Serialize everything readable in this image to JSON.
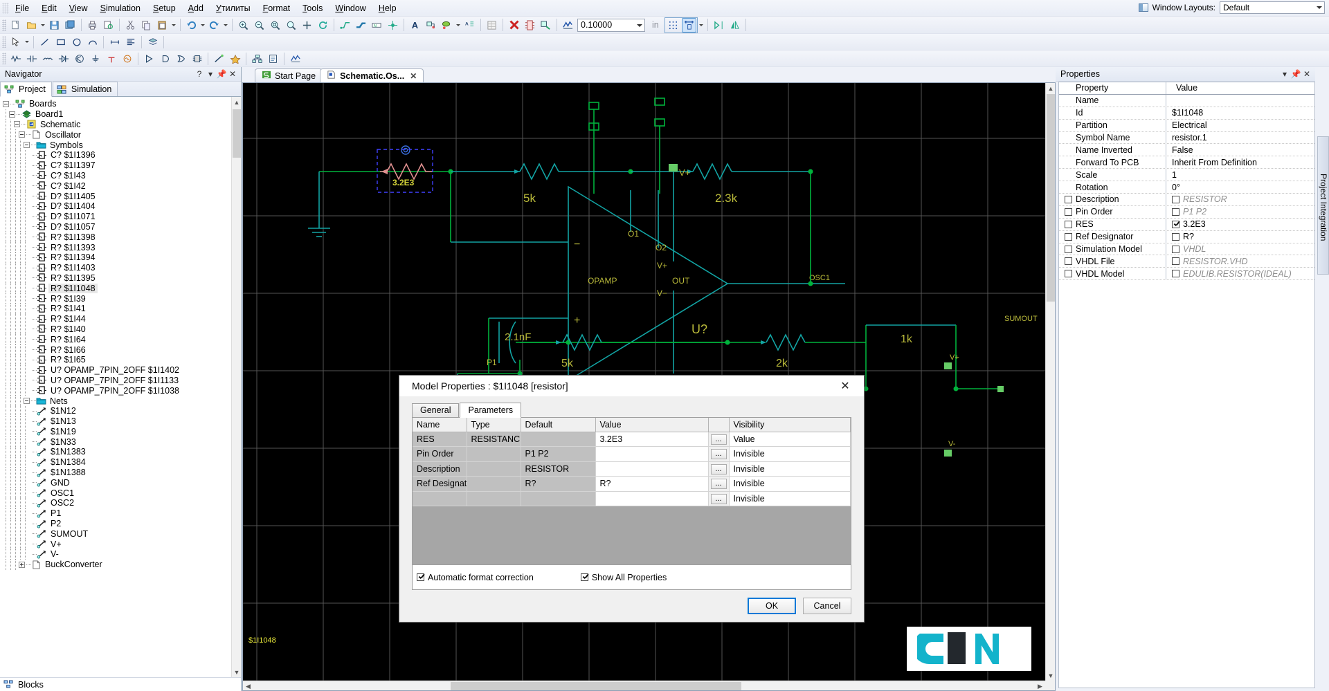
{
  "menu": {
    "items": [
      "File",
      "Edit",
      "View",
      "Simulation",
      "Setup",
      "Add",
      "Утилиты",
      "Format",
      "Tools",
      "Window",
      "Help"
    ]
  },
  "window_layouts": {
    "label": "Window Layouts:",
    "value": "Default"
  },
  "toolbar": {
    "zoom_value": "0.10000",
    "unit": "in"
  },
  "navigator": {
    "title": "Navigator",
    "tabs": [
      {
        "label": "Project",
        "icon": "project-icon",
        "active": true
      },
      {
        "label": "Simulation",
        "icon": "simulation-icon",
        "active": false
      }
    ],
    "tree": [
      {
        "label": "Boards",
        "depth": 0,
        "exp": "minus",
        "icon": "boards-icon"
      },
      {
        "label": "Board1",
        "depth": 1,
        "exp": "minus",
        "icon": "board-icon"
      },
      {
        "label": "Schematic",
        "depth": 2,
        "exp": "minus",
        "icon": "schematic-icon"
      },
      {
        "label": "Oscillator",
        "depth": 3,
        "exp": "minus",
        "icon": "page-icon"
      },
      {
        "label": "Symbols",
        "depth": 4,
        "exp": "minus",
        "icon": "folder-icon"
      },
      {
        "label": "C? $1I1396",
        "depth": 5,
        "exp": "none",
        "icon": "symbol-icon"
      },
      {
        "label": "C? $1I1397",
        "depth": 5,
        "exp": "none",
        "icon": "symbol-icon"
      },
      {
        "label": "C? $1I43",
        "depth": 5,
        "exp": "none",
        "icon": "symbol-icon"
      },
      {
        "label": "C? $1I42",
        "depth": 5,
        "exp": "none",
        "icon": "symbol-icon"
      },
      {
        "label": "D? $1I1405",
        "depth": 5,
        "exp": "none",
        "icon": "symbol-icon"
      },
      {
        "label": "D? $1I1404",
        "depth": 5,
        "exp": "none",
        "icon": "symbol-icon"
      },
      {
        "label": "D? $1I1071",
        "depth": 5,
        "exp": "none",
        "icon": "symbol-icon"
      },
      {
        "label": "D? $1I1057",
        "depth": 5,
        "exp": "none",
        "icon": "symbol-icon"
      },
      {
        "label": "R? $1I1398",
        "depth": 5,
        "exp": "none",
        "icon": "symbol-icon"
      },
      {
        "label": "R? $1I1393",
        "depth": 5,
        "exp": "none",
        "icon": "symbol-icon"
      },
      {
        "label": "R? $1I1394",
        "depth": 5,
        "exp": "none",
        "icon": "symbol-icon"
      },
      {
        "label": "R? $1I1403",
        "depth": 5,
        "exp": "none",
        "icon": "symbol-icon"
      },
      {
        "label": "R? $1I1395",
        "depth": 5,
        "exp": "none",
        "icon": "symbol-icon"
      },
      {
        "label": "R? $1I1048",
        "depth": 5,
        "exp": "none",
        "icon": "symbol-icon",
        "selected": true
      },
      {
        "label": "R? $1I39",
        "depth": 5,
        "exp": "none",
        "icon": "symbol-icon"
      },
      {
        "label": "R? $1I41",
        "depth": 5,
        "exp": "none",
        "icon": "symbol-icon"
      },
      {
        "label": "R? $1I44",
        "depth": 5,
        "exp": "none",
        "icon": "symbol-icon"
      },
      {
        "label": "R? $1I40",
        "depth": 5,
        "exp": "none",
        "icon": "symbol-icon"
      },
      {
        "label": "R? $1I64",
        "depth": 5,
        "exp": "none",
        "icon": "symbol-icon"
      },
      {
        "label": "R? $1I66",
        "depth": 5,
        "exp": "none",
        "icon": "symbol-icon"
      },
      {
        "label": "R? $1I65",
        "depth": 5,
        "exp": "none",
        "icon": "symbol-icon"
      },
      {
        "label": "U? OPAMP_7PIN_2OFF $1I1402",
        "depth": 5,
        "exp": "none",
        "icon": "symbol-icon"
      },
      {
        "label": "U? OPAMP_7PIN_2OFF $1I1133",
        "depth": 5,
        "exp": "none",
        "icon": "symbol-icon"
      },
      {
        "label": "U? OPAMP_7PIN_2OFF $1I1038",
        "depth": 5,
        "exp": "none",
        "icon": "symbol-icon"
      },
      {
        "label": "Nets",
        "depth": 4,
        "exp": "minus",
        "icon": "folder-icon"
      },
      {
        "label": "$1N12",
        "depth": 5,
        "exp": "none",
        "icon": "net-icon"
      },
      {
        "label": "$1N13",
        "depth": 5,
        "exp": "none",
        "icon": "net-icon"
      },
      {
        "label": "$1N19",
        "depth": 5,
        "exp": "none",
        "icon": "net-icon"
      },
      {
        "label": "$1N33",
        "depth": 5,
        "exp": "none",
        "icon": "net-icon"
      },
      {
        "label": "$1N1383",
        "depth": 5,
        "exp": "none",
        "icon": "net-icon"
      },
      {
        "label": "$1N1384",
        "depth": 5,
        "exp": "none",
        "icon": "net-icon"
      },
      {
        "label": "$1N1388",
        "depth": 5,
        "exp": "none",
        "icon": "net-icon"
      },
      {
        "label": "GND",
        "depth": 5,
        "exp": "none",
        "icon": "net-icon"
      },
      {
        "label": "OSC1",
        "depth": 5,
        "exp": "none",
        "icon": "net-icon"
      },
      {
        "label": "OSC2",
        "depth": 5,
        "exp": "none",
        "icon": "net-icon"
      },
      {
        "label": "P1",
        "depth": 5,
        "exp": "none",
        "icon": "net-icon"
      },
      {
        "label": "P2",
        "depth": 5,
        "exp": "none",
        "icon": "net-icon"
      },
      {
        "label": "SUMOUT",
        "depth": 5,
        "exp": "none",
        "icon": "net-icon"
      },
      {
        "label": "V+",
        "depth": 5,
        "exp": "none",
        "icon": "net-icon"
      },
      {
        "label": "V-",
        "depth": 5,
        "exp": "none",
        "icon": "net-icon"
      },
      {
        "label": "BuckConverter",
        "depth": 3,
        "exp": "plus",
        "icon": "page-icon"
      }
    ],
    "footer": {
      "label": "Blocks",
      "icon": "blocks-icon"
    }
  },
  "doc_tabs": [
    {
      "label": "Start Page",
      "icon": "start-page-icon",
      "active": false,
      "closable": false
    },
    {
      "label": "Schematic.Os...",
      "icon": "schematic-doc-icon",
      "active": true,
      "closable": true
    }
  ],
  "schematic": {
    "status_label": "$1I1048",
    "labels": {
      "selected_resistor": "3.2E3",
      "r_5k_left": "5k",
      "r_2k3": "2.3k",
      "c_2p1nF": "2.1nF",
      "r_5k_mid": "5k",
      "r_2k": "2k",
      "r_1k": "1k",
      "opamp_name": "OPAMP",
      "opamp_ref": "U?",
      "pin_o1": "O1",
      "pin_o2": "O2",
      "pin_vplus": "V+",
      "pin_vminus": "V-",
      "pin_out": "OUT",
      "net_osc1": "OSC1",
      "net_p1": "P1",
      "net_sumout": "SUMOUT",
      "net_vplus": "V+",
      "net_vminus": "V-"
    },
    "colors": {
      "wire_green": "#00b33c",
      "wire_teal": "#12a3a3",
      "label_yellow": "#cfcf3a",
      "selection_blue": "#4040ff",
      "selected_part": "#e08080",
      "grid": "#5a5a5a",
      "background": "#000000"
    }
  },
  "properties": {
    "title": "Properties",
    "side_tab": "Project Integration",
    "header": {
      "property": "Property",
      "value": "Value"
    },
    "rows": [
      {
        "name": "Name",
        "value": "",
        "has_name_cb": false,
        "has_value_cb": false,
        "value_dim": false
      },
      {
        "name": "Id",
        "value": "$1I1048",
        "has_name_cb": false,
        "has_value_cb": false,
        "value_dim": false
      },
      {
        "name": "Partition",
        "value": "Electrical",
        "has_name_cb": false,
        "has_value_cb": false,
        "value_dim": false
      },
      {
        "name": "Symbol Name",
        "value": "resistor.1",
        "has_name_cb": false,
        "has_value_cb": false,
        "value_dim": false
      },
      {
        "name": "Name Inverted",
        "value": "False",
        "has_name_cb": false,
        "has_value_cb": false,
        "value_dim": false
      },
      {
        "name": "Forward To PCB",
        "value": "Inherit From Definition",
        "has_name_cb": false,
        "has_value_cb": false,
        "value_dim": false
      },
      {
        "name": "Scale",
        "value": "1",
        "has_name_cb": false,
        "has_value_cb": false,
        "value_dim": false
      },
      {
        "name": "Rotation",
        "value": "0°",
        "has_name_cb": false,
        "has_value_cb": false,
        "value_dim": false
      },
      {
        "name": "Description",
        "value": "RESISTOR",
        "has_name_cb": true,
        "has_value_cb": true,
        "name_checked": false,
        "value_checked": false,
        "value_dim": true
      },
      {
        "name": "Pin Order",
        "value": "P1 P2",
        "has_name_cb": true,
        "has_value_cb": true,
        "name_checked": false,
        "value_checked": false,
        "value_dim": true
      },
      {
        "name": "RES",
        "value": "3.2E3",
        "has_name_cb": true,
        "has_value_cb": true,
        "name_checked": false,
        "value_checked": true,
        "value_dim": false
      },
      {
        "name": "Ref Designator",
        "value": "R?",
        "has_name_cb": true,
        "has_value_cb": true,
        "name_checked": false,
        "value_checked": false,
        "value_dim": false
      },
      {
        "name": "Simulation Model",
        "value": "VHDL",
        "has_name_cb": true,
        "has_value_cb": true,
        "name_checked": false,
        "value_checked": false,
        "value_dim": true
      },
      {
        "name": "VHDL File",
        "value": "RESISTOR.VHD",
        "has_name_cb": true,
        "has_value_cb": true,
        "name_checked": false,
        "value_checked": false,
        "value_dim": true
      },
      {
        "name": "VHDL Model",
        "value": "EDULIB.RESISTOR(IDEAL)",
        "has_name_cb": true,
        "has_value_cb": true,
        "name_checked": false,
        "value_checked": false,
        "value_dim": true
      }
    ]
  },
  "dialog": {
    "title": "Model Properties : $1I1048 [resistor]",
    "tabs": [
      {
        "label": "General",
        "active": false
      },
      {
        "label": "Parameters",
        "active": true
      }
    ],
    "table": {
      "columns": [
        "Name",
        "Type",
        "Default",
        "Value",
        "",
        "Visibility"
      ],
      "rows": [
        {
          "name": "RES",
          "type": "RESISTANCE",
          "default": "",
          "value": "3.2E3",
          "button": "...",
          "visibility": "Value"
        },
        {
          "name": "Pin Order",
          "type": "",
          "default": "P1 P2",
          "value": "",
          "button": "...",
          "visibility": "Invisible"
        },
        {
          "name": "Description",
          "type": "",
          "default": "RESISTOR",
          "value": "",
          "button": "...",
          "visibility": "Invisible"
        },
        {
          "name": "Ref Designator",
          "type": "",
          "default": "R?",
          "value": "R?",
          "button": "...",
          "visibility": "Invisible"
        },
        {
          "name": "",
          "type": "",
          "default": "",
          "value": "",
          "button": "...",
          "visibility": "Invisible"
        }
      ]
    },
    "options": [
      {
        "label": "Automatic format correction",
        "checked": true
      },
      {
        "label": "Show All Properties",
        "checked": true
      }
    ],
    "buttons": [
      {
        "label": "OK",
        "default": true
      },
      {
        "label": "Cancel",
        "default": false
      }
    ]
  }
}
